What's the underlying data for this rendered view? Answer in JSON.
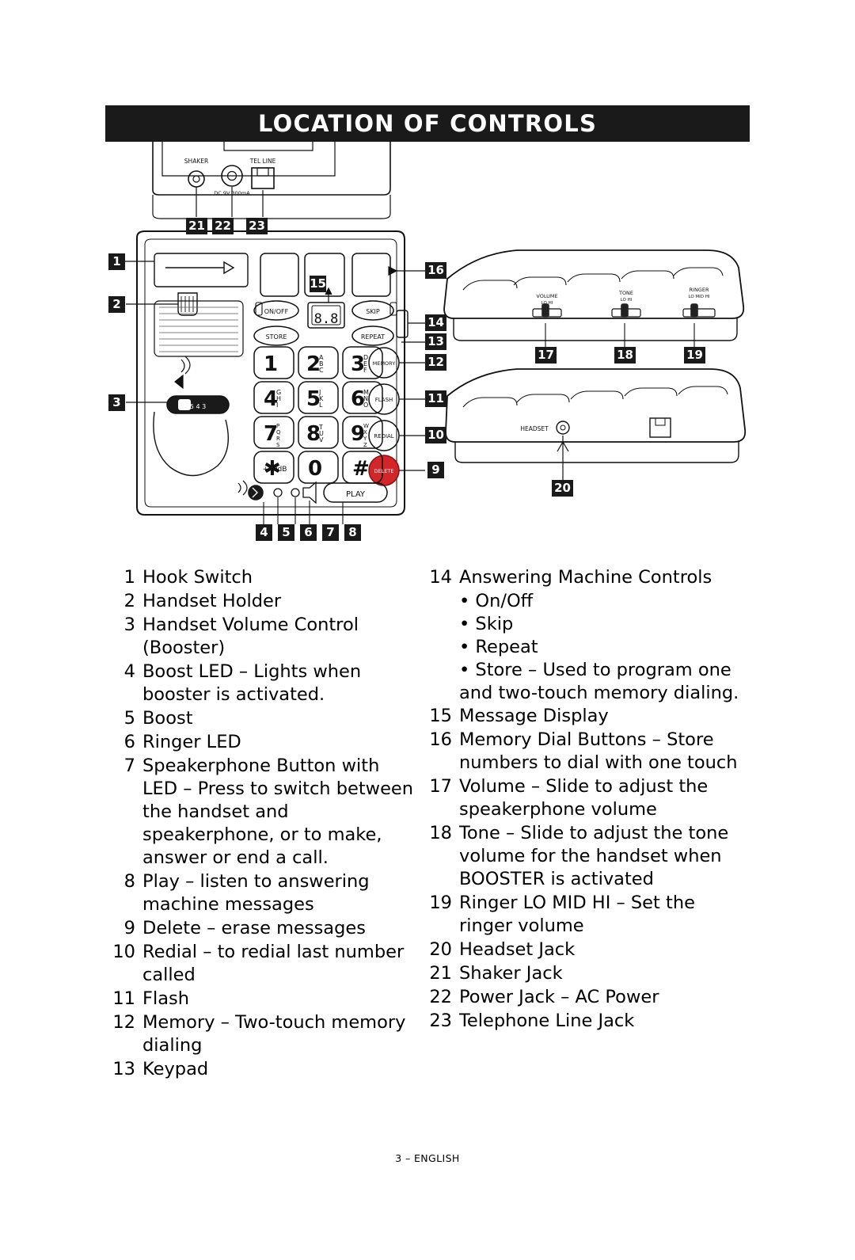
{
  "header": {
    "title": "LOCATION OF CONTROLS"
  },
  "figure": {
    "callouts": [
      "1",
      "2",
      "3",
      "4",
      "5",
      "6",
      "7",
      "8",
      "9",
      "10",
      "11",
      "12",
      "13",
      "14",
      "15",
      "16",
      "17",
      "18",
      "19",
      "20",
      "21",
      "22",
      "23"
    ],
    "labels": {
      "shaker": "SHAKER",
      "dc_jack": "DC 9V 300mA",
      "telline": "TEL LINE",
      "onoff": "ON/OFF",
      "store": "STORE",
      "skip": "SKIP",
      "repeat": "REPEAT",
      "memory": "MEMORY",
      "flash": "FLASH",
      "redial": "REDIAL",
      "delete": "DELETE",
      "play": "PLAY",
      "boost_db": "+40dB",
      "display": "8.8",
      "booster_scale": "5  4  3",
      "volume": "VOLUME",
      "volume_range": "LO        HI",
      "tone": "TONE",
      "tone_range": "LO        HI",
      "ringer": "RINGER",
      "ringer_range": "LO  MID  HI",
      "headset": "HEADSET"
    },
    "keypad": [
      {
        "d": "1",
        "l": ""
      },
      {
        "d": "2",
        "l": "ABC"
      },
      {
        "d": "3",
        "l": "DEF"
      },
      {
        "d": "4",
        "l": "GHI"
      },
      {
        "d": "5",
        "l": "JKL"
      },
      {
        "d": "6",
        "l": "MNO"
      },
      {
        "d": "7",
        "l": "PQRS"
      },
      {
        "d": "8",
        "l": "TUV"
      },
      {
        "d": "9",
        "l": "WXYZ"
      },
      {
        "d": "✱",
        "l": ""
      },
      {
        "d": "0",
        "l": ""
      },
      {
        "d": "#",
        "l": ""
      }
    ]
  },
  "legend": {
    "left": [
      {
        "num": "1",
        "text": "Hook Switch"
      },
      {
        "num": "2",
        "text": "Handset Holder"
      },
      {
        "num": "3",
        "text": "Handset Volume Control (Booster)"
      },
      {
        "num": "4",
        "text": "Boost LED – Lights when booster is activated."
      },
      {
        "num": "5",
        "text": "Boost"
      },
      {
        "num": "6",
        "text": "Ringer LED"
      },
      {
        "num": "7",
        "text": "Speakerphone Button with LED – Press to switch between the handset and speakerphone, or to make, answer or end a call."
      },
      {
        "num": "8",
        "text": "Play – listen to answering machine messages"
      },
      {
        "num": "9",
        "text": "Delete – erase messages"
      },
      {
        "num": "10",
        "text": "Redial – to redial last number called"
      },
      {
        "num": "11",
        "text": "Flash"
      },
      {
        "num": "12",
        "text": "Memory – Two-touch memory dialing"
      },
      {
        "num": "13",
        "text": "Keypad"
      }
    ],
    "right": [
      {
        "num": "14",
        "text": "Answering Machine Controls",
        "bullets": [
          "• On/Off",
          "• Skip",
          "• Repeat",
          "• Store – Used to program one and two-touch memory dialing."
        ]
      },
      {
        "num": "15",
        "text": "Message Display"
      },
      {
        "num": "16",
        "text": "Memory Dial Buttons – Store numbers to dial with one touch"
      },
      {
        "num": "17",
        "text": "Volume – Slide to adjust the speakerphone volume"
      },
      {
        "num": "18",
        "text": "Tone – Slide to adjust the tone volume for the handset when BOOSTER is activated"
      },
      {
        "num": "19",
        "text": "Ringer LO MID HI – Set the ringer volume"
      },
      {
        "num": "20",
        "text": "Headset Jack"
      },
      {
        "num": "21",
        "text": "Shaker Jack"
      },
      {
        "num": "22",
        "text": "Power Jack – AC Power"
      },
      {
        "num": "23",
        "text": "Telephone Line Jack"
      }
    ]
  },
  "footer": {
    "text": "3 – ENGLISH"
  }
}
